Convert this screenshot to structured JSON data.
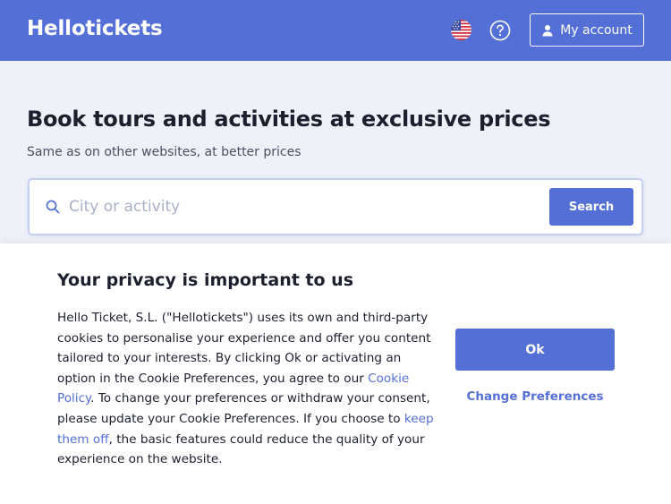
{
  "header": {
    "logo": "Hellotickets",
    "language_icon": "us-flag-icon",
    "help_icon": "question-circle-icon",
    "account_icon": "user-icon",
    "account_label": "My account"
  },
  "hero": {
    "title": "Book tours and activities at exclusive prices",
    "subtitle": "Same as on other websites, at better prices"
  },
  "search": {
    "placeholder": "City or activity",
    "button_label": "Search"
  },
  "cookie_banner": {
    "title": "Your privacy is important to us",
    "text_part1": "Hello Ticket, S.L. (\"Hellotickets\") uses its own and third-party cookies to personalise your experience and offer you content tailored to your interests. By clicking Ok or activating an option in the Cookie Preferences, you agree to our ",
    "cookie_policy_link": "Cookie Policy",
    "text_part2": ". To change your preferences or withdraw your consent, please update your Cookie Preferences. If you choose to ",
    "keep_off_link": "keep them off",
    "text_part3": ", the basic features could reduce the quality of your experience on the website.",
    "ok_label": "Ok",
    "change_preferences_label": "Change Preferences"
  },
  "colors": {
    "brand": "#5470d7",
    "page_background": "#eef1f8",
    "text": "#1c1f2e"
  }
}
